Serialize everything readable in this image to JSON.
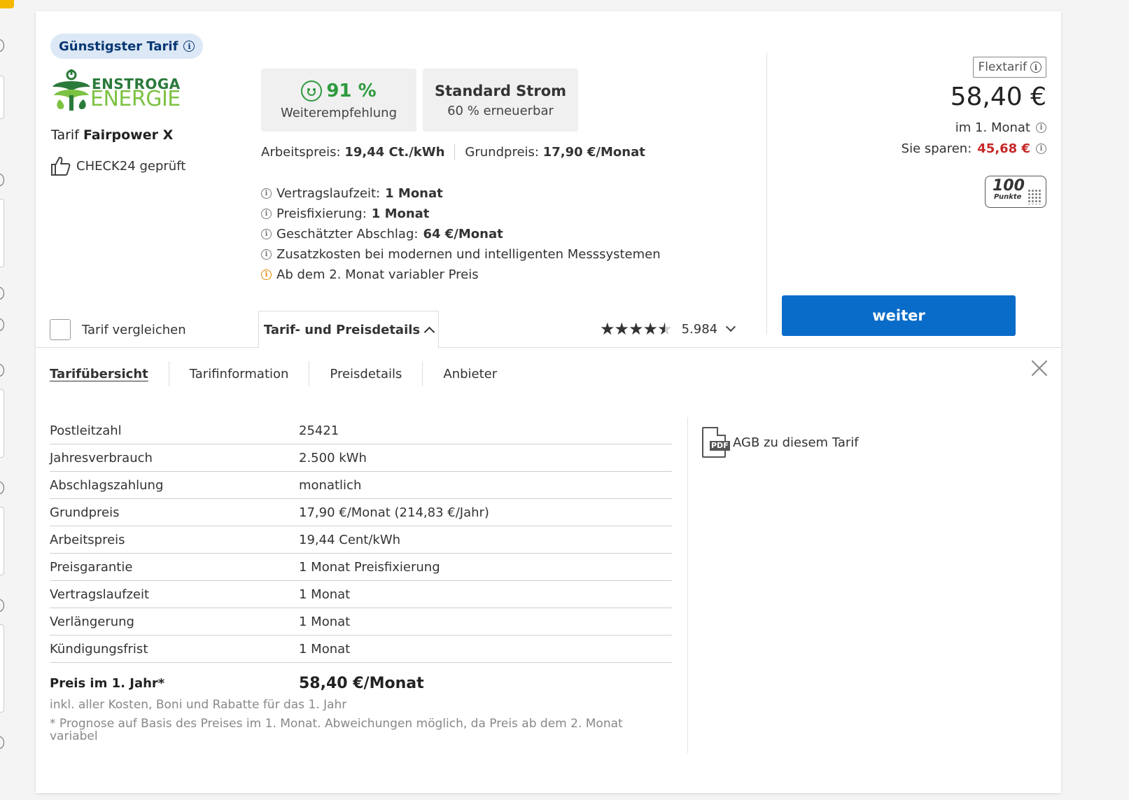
{
  "badge": {
    "label": "Günstigster Tarif"
  },
  "provider": {
    "logo_top": "ENSTROGA",
    "logo_bottom": "ENERGIE"
  },
  "tariff": {
    "prefix": "Tarif",
    "name": "Fairpower X"
  },
  "check24": {
    "label": "CHECK24 geprüft"
  },
  "recommendation": {
    "value": "91 %",
    "label": "Weiterempfehlung"
  },
  "energy": {
    "title": "Standard Strom",
    "subtitle": "60 % erneuerbar"
  },
  "prices": {
    "arbeitspreis_label": "Arbeitspreis:",
    "arbeitspreis_value": "19,44 Ct./kWh",
    "grundpreis_label": "Grundpreis:",
    "grundpreis_value": "17,90 €/Monat"
  },
  "facts": [
    {
      "label": "Vertragslaufzeit:",
      "value": "1 Monat"
    },
    {
      "label": "Preisfixierung:",
      "value": "1 Monat"
    },
    {
      "label": "Geschätzter Abschlag:",
      "value": "64 €/Monat"
    },
    {
      "label": "Zusatzkosten bei modernen und intelligenten Messsystemen",
      "value": ""
    },
    {
      "label": "Ab dem 2. Monat variabler Preis",
      "value": ""
    }
  ],
  "price_box": {
    "tag": "Flextarif",
    "price": "58,40 €",
    "period": "im 1. Monat",
    "save_label": "Sie sparen:",
    "save_value": "45,68 €",
    "points_value": "100",
    "points_label": "Punkte"
  },
  "cta": {
    "label": "weiter"
  },
  "compare": {
    "label": "Tarif vergleichen"
  },
  "details_tab": {
    "label": "Tarif- und Preisdetails"
  },
  "rating": {
    "count": "5.984",
    "stars": 4.5
  },
  "subnav": [
    "Tarifübersicht",
    "Tarifinformation",
    "Preisdetails",
    "Anbieter"
  ],
  "overview": [
    {
      "key": "Postleitzahl",
      "value": "25421"
    },
    {
      "key": "Jahresverbrauch",
      "value": "2.500 kWh"
    },
    {
      "key": "Abschlagszahlung",
      "value": "monatlich"
    },
    {
      "key": "Grundpreis",
      "value": "17,90 €/Monat (214,83 €/Jahr)"
    },
    {
      "key": "Arbeitspreis",
      "value": "19,44 Cent/kWh"
    },
    {
      "key": "Preisgarantie",
      "value": "1 Monat Preisfixierung"
    },
    {
      "key": "Vertragslaufzeit",
      "value": "1 Monat"
    },
    {
      "key": "Verlängerung",
      "value": "1 Monat"
    },
    {
      "key": "Kündigungsfrist",
      "value": "1 Monat"
    }
  ],
  "summary": {
    "label": "Preis im 1. Jahr*",
    "value": "58,40 €/Monat",
    "note1": "inkl. aller Kosten, Boni und Rabatte für das 1. Jahr",
    "note2": "* Prognose auf Basis des Preises im 1. Monat. Abweichungen möglich, da Preis ab dem 2. Monat variabel"
  },
  "agb": {
    "label": "AGB zu diesem Tarif",
    "icon_text": "PDF"
  },
  "colors": {
    "brand_blue": "#0a6cc9",
    "badge_bg": "#dce8f5",
    "badge_text": "#063773",
    "green": "#2e9a3e",
    "save_red": "#c62828"
  }
}
